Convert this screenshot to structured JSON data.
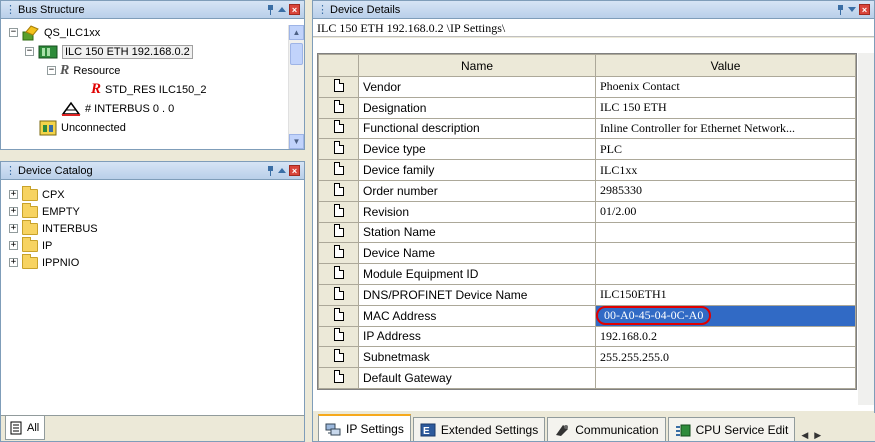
{
  "bus_structure": {
    "title": "Bus Structure",
    "items": [
      {
        "label": "QS_ILC1xx"
      },
      {
        "label": "ILC 150 ETH 192.168.0.2"
      },
      {
        "label": "Resource"
      },
      {
        "label": "STD_RES ILC150_2"
      },
      {
        "label": "# INTERBUS 0 . 0"
      },
      {
        "label": "Unconnected"
      }
    ]
  },
  "device_catalog": {
    "title": "Device Catalog",
    "items": [
      {
        "label": "CPX"
      },
      {
        "label": "EMPTY"
      },
      {
        "label": "INTERBUS"
      },
      {
        "label": "IP"
      },
      {
        "label": "IPPNIO"
      }
    ],
    "bottom_tab": "All"
  },
  "device_details": {
    "title": "Device Details",
    "path": "ILC 150 ETH 192.168.0.2 \\IP Settings\\",
    "columns": [
      "Name",
      "Value"
    ],
    "rows": [
      {
        "name": "Vendor",
        "value": "Phoenix Contact"
      },
      {
        "name": "Designation",
        "value": "ILC 150 ETH"
      },
      {
        "name": "Functional description",
        "value": "Inline Controller for Ethernet Network..."
      },
      {
        "name": "Device type",
        "value": "PLC"
      },
      {
        "name": "Device family",
        "value": "ILC1xx"
      },
      {
        "name": "Order number",
        "value": "2985330"
      },
      {
        "name": "Revision",
        "value": "01/2.00"
      },
      {
        "name": "Station Name",
        "value": ""
      },
      {
        "name": "Device Name",
        "value": ""
      },
      {
        "name": "Module Equipment ID",
        "value": ""
      },
      {
        "name": "DNS/PROFINET Device Name",
        "value": "ILC150ETH1"
      },
      {
        "name": "MAC Address",
        "value": "00-A0-45-04-0C-A0"
      },
      {
        "name": "IP Address",
        "value": "192.168.0.2"
      },
      {
        "name": "Subnetmask",
        "value": "255.255.255.0"
      },
      {
        "name": "Default Gateway",
        "value": ""
      }
    ],
    "tabs": [
      {
        "label": "IP Settings"
      },
      {
        "label": "Extended Settings"
      },
      {
        "label": "Communication"
      },
      {
        "label": "CPU Service Edit"
      }
    ]
  },
  "colors": {
    "selection": "#316ac5",
    "highlight_ring": "#e00000",
    "folder": "#f7d361"
  }
}
